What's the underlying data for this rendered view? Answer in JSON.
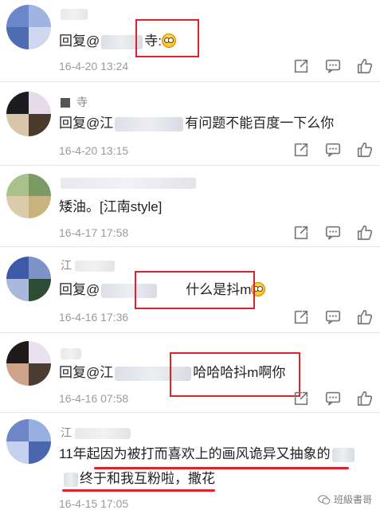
{
  "comments": [
    {
      "username": "",
      "reply_prefix": "回复@",
      "after_name": "寺:",
      "has_emoji": true,
      "time": "16-4-20 13:24",
      "avatar_colors": [
        "#6b86c9",
        "#9fb4e3",
        "#4d6cb2",
        "#cfd8ee"
      ]
    },
    {
      "username": "寺",
      "reply_prefix": "回复@",
      "mention_part": "江",
      "after_name": "有问题不能百度一下么你",
      "time": "16-4-20 13:15",
      "avatar_colors": [
        "#1c1b1f",
        "#4a3a2c",
        "#d9c5a8",
        "#f0e2c6"
      ]
    },
    {
      "username": "",
      "text": "矮油。[江南style]",
      "time": "16-4-17 17:58",
      "avatar_colors": [
        "#a9c28b",
        "#7c9a63",
        "#c9b47f",
        "#d8ccaa"
      ]
    },
    {
      "username": "江",
      "reply_prefix": "回复@",
      "after_name": "什么是抖m",
      "has_emoji": true,
      "time": "16-4-16 17:36",
      "avatar_colors": [
        "#3d5aa8",
        "#7c92c9",
        "#2d4b35",
        "#a9b8dc"
      ]
    },
    {
      "username": "",
      "reply_prefix": "回复@",
      "mention_part": "江",
      "after_name": "哈哈哈抖m啊你",
      "time": "16-4-16 07:58",
      "avatar_colors": [
        "#1f1b1a",
        "#4b3b33",
        "#cfa38a",
        "#ecd6c4"
      ]
    },
    {
      "username": "江",
      "line1": "11年起因为被打而喜欢上的画风诡异又抽象的",
      "line2": "终于和我互粉啦，撒花",
      "time": "16-4-15 17:05",
      "avatar_colors": [
        "#6d86c7",
        "#97aee1",
        "#4b66ad",
        "#c5d1ee"
      ]
    }
  ],
  "actions": {
    "share_icon": "share-icon",
    "comment_icon": "comment-icon",
    "like_icon": "thumbs-up-icon"
  },
  "watermark": {
    "text": "班級書哥",
    "icon": "wechat-icon"
  },
  "colors": {
    "highlight_red": "#e0202a",
    "time_gray": "#9a9a9a",
    "text_dark": "#222222"
  }
}
